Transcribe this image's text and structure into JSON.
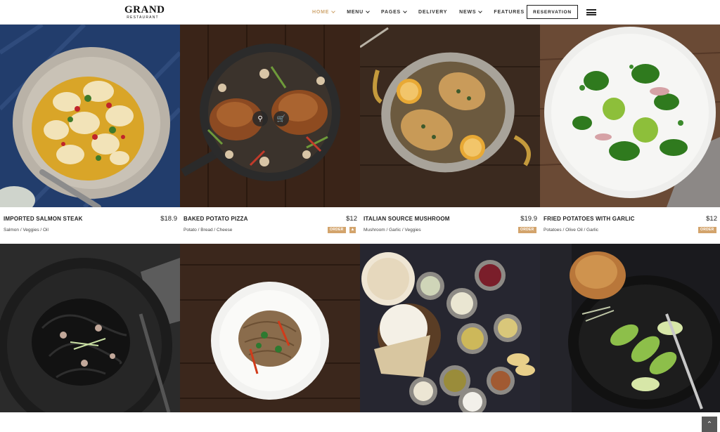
{
  "brand": {
    "name": "GRAND",
    "tagline": "RESTAURANT"
  },
  "nav": {
    "items": [
      {
        "label": "HOME",
        "dropdown": true,
        "active": true
      },
      {
        "label": "MENU",
        "dropdown": true,
        "active": false
      },
      {
        "label": "PAGES",
        "dropdown": true,
        "active": false
      },
      {
        "label": "DELIVERY",
        "dropdown": false,
        "active": false
      },
      {
        "label": "NEWS",
        "dropdown": true,
        "active": false
      },
      {
        "label": "FEATURES",
        "dropdown": true,
        "active": false
      }
    ],
    "reservation_label": "RESERVATION",
    "accent_color": "#cfa670"
  },
  "menu_items": [
    {
      "name": "IMPORTED SALMON STEAK",
      "price": "$18.9",
      "tags": "Salmon / Veggies / Oil"
    },
    {
      "name": "BAKED POTATO PIZZA",
      "price": "$12",
      "tags": "Potato / Bread / Cheese",
      "order_label": "ORDER"
    },
    {
      "name": "ITALIAN SOURCE MUSHROOM",
      "price": "$19.9",
      "tags": "Mushroom / Garlic / Veggies",
      "order_label": "ORDER"
    },
    {
      "name": "FRIED POTATOES WITH GARLIC",
      "price": "$12",
      "tags": "Potatoes / Olive Oil / Garlic",
      "order_label": "ORDER"
    }
  ],
  "icons": {
    "hover_search": "search-icon",
    "hover_cart": "cart-icon",
    "scroll_top": "chevron-up-icon",
    "menu": "hamburger-icon"
  }
}
